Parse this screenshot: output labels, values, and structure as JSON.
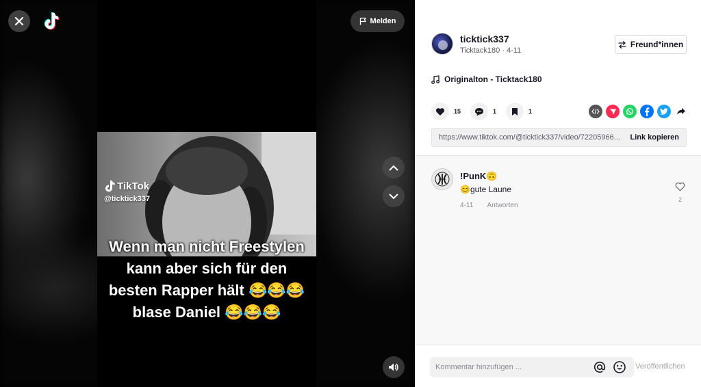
{
  "video": {
    "watermark_brand": "TikTok",
    "watermark_handle": "@ticktick337",
    "caption_lines": [
      "Wenn man nicht Freestylen",
      "kann aber sich für den",
      "besten Rapper hält 😂😂😂",
      "blase Daniel 😂😂😂"
    ],
    "report_label": "Melden"
  },
  "author": {
    "username": "ticktick337",
    "subtitle": "Ticktack180 · 4-11",
    "follow_label": "Freund*innen"
  },
  "sound": {
    "label": "Originalton - Ticktack180"
  },
  "actions": {
    "likes": "15",
    "comments": "1",
    "saves": "1"
  },
  "share": {
    "icons": [
      "embed-icon",
      "send-icon",
      "whatsapp-icon",
      "facebook-icon",
      "twitter-icon",
      "share-arrow-icon"
    ],
    "colors": {
      "embed": "#555555",
      "send": "#fe2c55",
      "whatsapp": "#25d366",
      "facebook": "#0075fa",
      "twitter": "#1da1f2"
    }
  },
  "link": {
    "url": "https://www.tiktok.com/@ticktick337/video/72205966...",
    "copy_label": "Link kopieren"
  },
  "comments": [
    {
      "user": "!PunK",
      "user_emoji": "🙃",
      "text": "😊gute Laune",
      "date": "4-11",
      "reply_label": "Antworten",
      "likes": "2"
    }
  ],
  "composer": {
    "placeholder": "Kommentar hinzufügen ...",
    "publish_label": "Veröffentlichen"
  }
}
